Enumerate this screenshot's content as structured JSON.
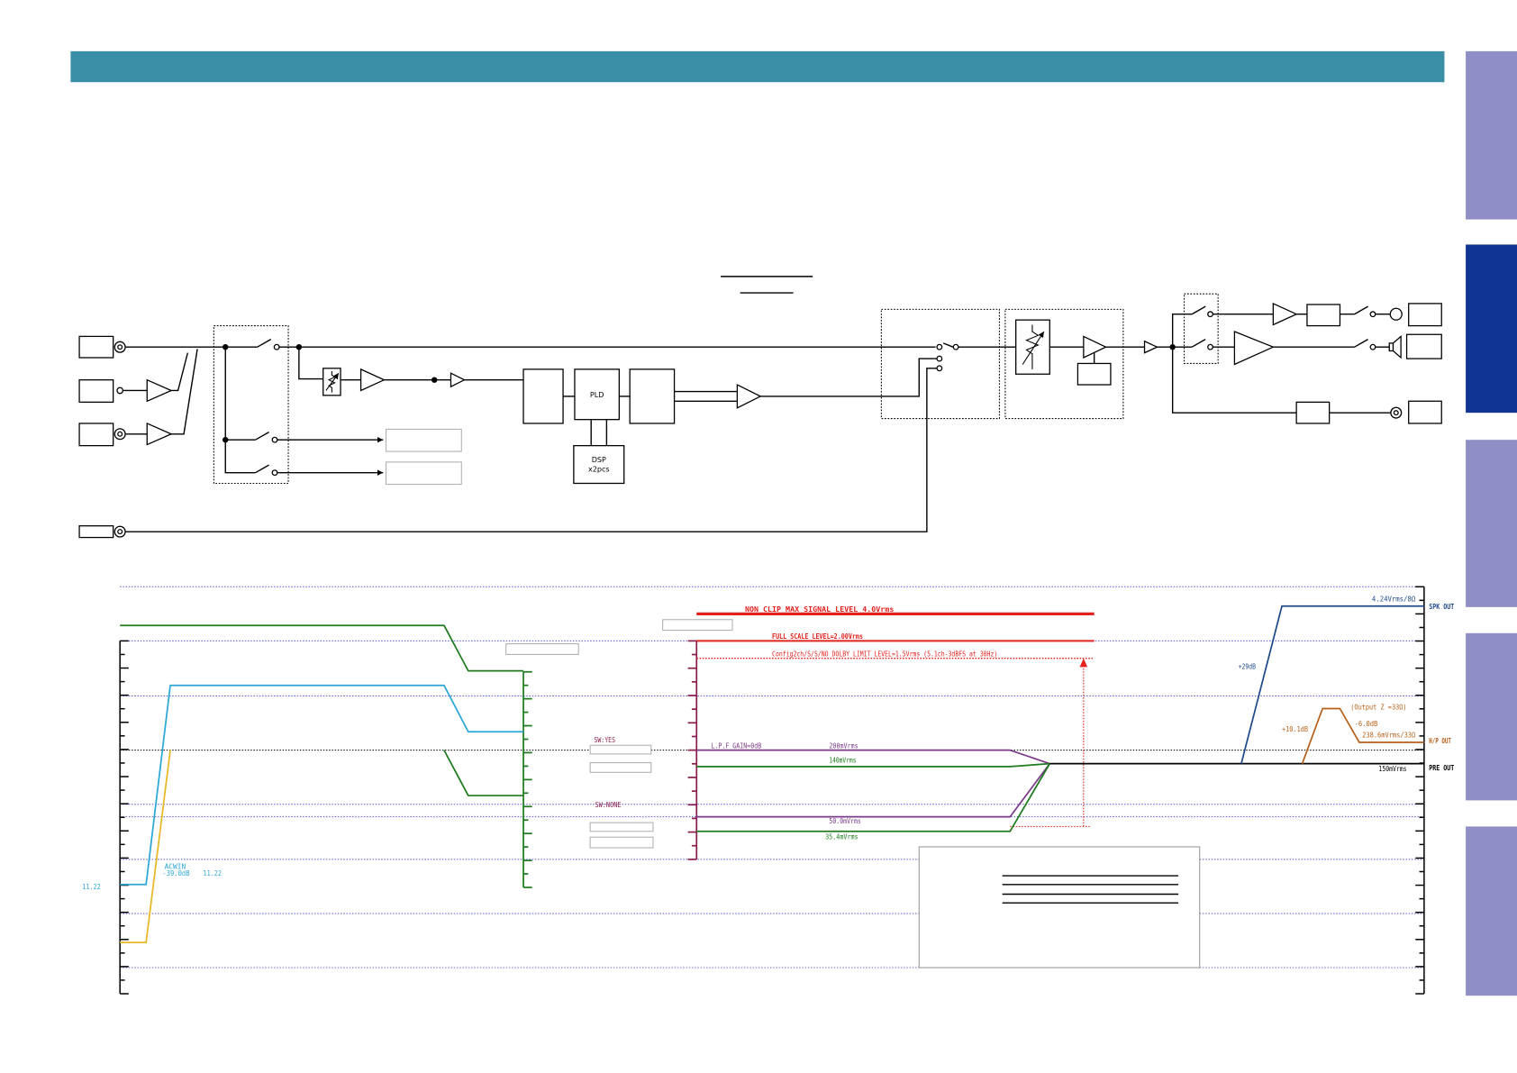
{
  "header": {
    "color": "#3a8fa6"
  },
  "side_tabs": [
    {
      "color": "#8f8fc5"
    },
    {
      "color": "#0f3491"
    },
    {
      "color": "#8f8fc5"
    },
    {
      "color": "#8f8fc5"
    },
    {
      "color": "#8f8fc5"
    }
  ],
  "block_diagram": {
    "pld": "PLD",
    "dsp": "DSP",
    "dsp_qty": "x2pcs"
  },
  "level_diagram": {
    "max_signal": "NON CLIP MAX SIGNAL LEVEL 4.0Vrms",
    "full_scale": "FULL SCALE LEVEL=2.00Vrms",
    "limit_level": "Config2ch/S/S/NO DOLBY LIMIT LEVEL=1.5Vrms (5.1ch-3dBFS at 30Hz)",
    "input": {
      "level_left": "11.22",
      "attenuation_label": "ACWIN",
      "attenuation": "-39.0dB",
      "level_right": "11.22"
    },
    "dsp_switch": {
      "yes": "SW:YES",
      "none": "SW:NONE"
    },
    "lpf": {
      "gain": "L.P.F GAIN=0dB",
      "level_1": "200mVrms",
      "level_2": "140mVrms",
      "level_3": "50.0mVrms",
      "level_4": "35.4mVrms"
    },
    "spk_out": {
      "level": "4.24Vrms/8Ω",
      "label": "SPK OUT",
      "gain": "+29dB"
    },
    "hp_out": {
      "output_z": "(Output Z =33Ω)",
      "gain": "+10.1dB",
      "attenuation": "-6.0dB",
      "level": "238.6mVrms/33Ω",
      "label": "H/P OUT"
    },
    "pre_out": {
      "level": "150mVrms",
      "label": "PRE OUT"
    },
    "colors": {
      "red": "#e3211d",
      "spk": "#1f4a8a",
      "hp": "#b5601a",
      "green": "#1d7a1d",
      "cyan": "#2aa6d6",
      "yellow": "#e6b820",
      "purple": "#7b3a8a"
    }
  }
}
